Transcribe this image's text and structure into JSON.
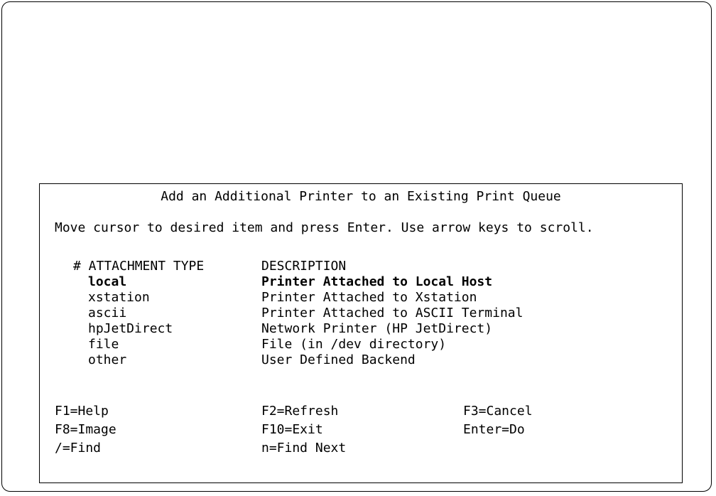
{
  "dialog": {
    "title": "Add an Additional Printer to an Existing Print Queue",
    "instruction": "Move cursor to desired item and press Enter. Use arrow keys to scroll.",
    "columns": {
      "type_header": "# ATTACHMENT TYPE",
      "description_header": "DESCRIPTION"
    },
    "items": [
      {
        "type": "local",
        "description": "Printer Attached to Local Host",
        "selected": true
      },
      {
        "type": "xstation",
        "description": "Printer Attached to Xstation",
        "selected": false
      },
      {
        "type": "ascii",
        "description": "Printer Attached to ASCII Terminal",
        "selected": false
      },
      {
        "type": "hpJetDirect",
        "description": "Network Printer (HP JetDirect)",
        "selected": false
      },
      {
        "type": "file",
        "description": "File (in /dev directory)",
        "selected": false
      },
      {
        "type": "other",
        "description": "User Defined Backend",
        "selected": false
      }
    ],
    "function_keys": {
      "help": "F1=Help",
      "refresh": "F2=Refresh",
      "cancel": "F3=Cancel",
      "image": "F8=Image",
      "exit": "F10=Exit",
      "do": "Enter=Do",
      "find": "/=Find",
      "find_next": "n=Find Next"
    }
  }
}
